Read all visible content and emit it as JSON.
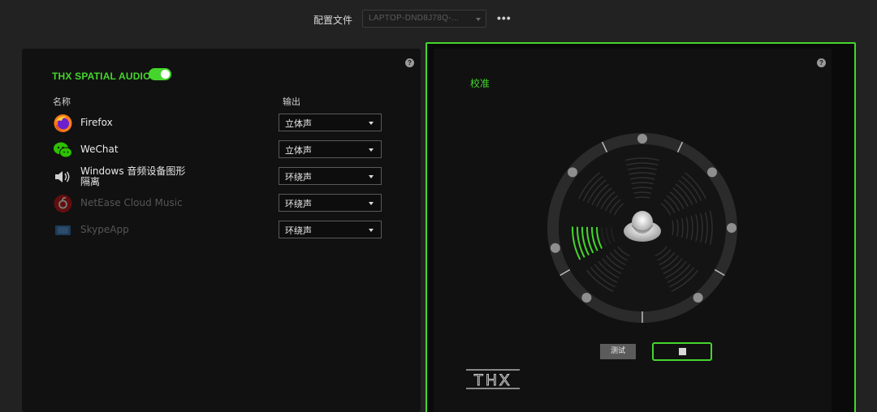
{
  "topbar": {
    "profile_label": "配置文件",
    "profile_value": "LAPTOP-DND8J78Q-...",
    "more_label": "•••"
  },
  "spatial_audio": {
    "title": "THX SPATIAL AUDIO",
    "enabled": true,
    "col_name": "名称",
    "col_output": "输出",
    "apps": [
      {
        "name": "Firefox",
        "output": "立体声",
        "icon": "firefox-icon",
        "active": true
      },
      {
        "name": "WeChat",
        "output": "立体声",
        "icon": "wechat-icon",
        "active": true
      },
      {
        "name": "Windows 音频设备图形隔离",
        "output": "环绕声",
        "icon": "speaker-icon",
        "active": true
      },
      {
        "name": "NetEase Cloud Music",
        "output": "环绕声",
        "icon": "netease-music-icon",
        "active": false
      },
      {
        "name": "SkypeApp",
        "output": "环绕声",
        "icon": "skype-icon",
        "active": false
      }
    ]
  },
  "calibration": {
    "title": "校准",
    "test_button": "测试",
    "stop_button_icon": "stop-icon",
    "logo_text": "THX"
  },
  "colors": {
    "accent": "#44d62c",
    "panel": "#111111",
    "background": "#222222"
  }
}
